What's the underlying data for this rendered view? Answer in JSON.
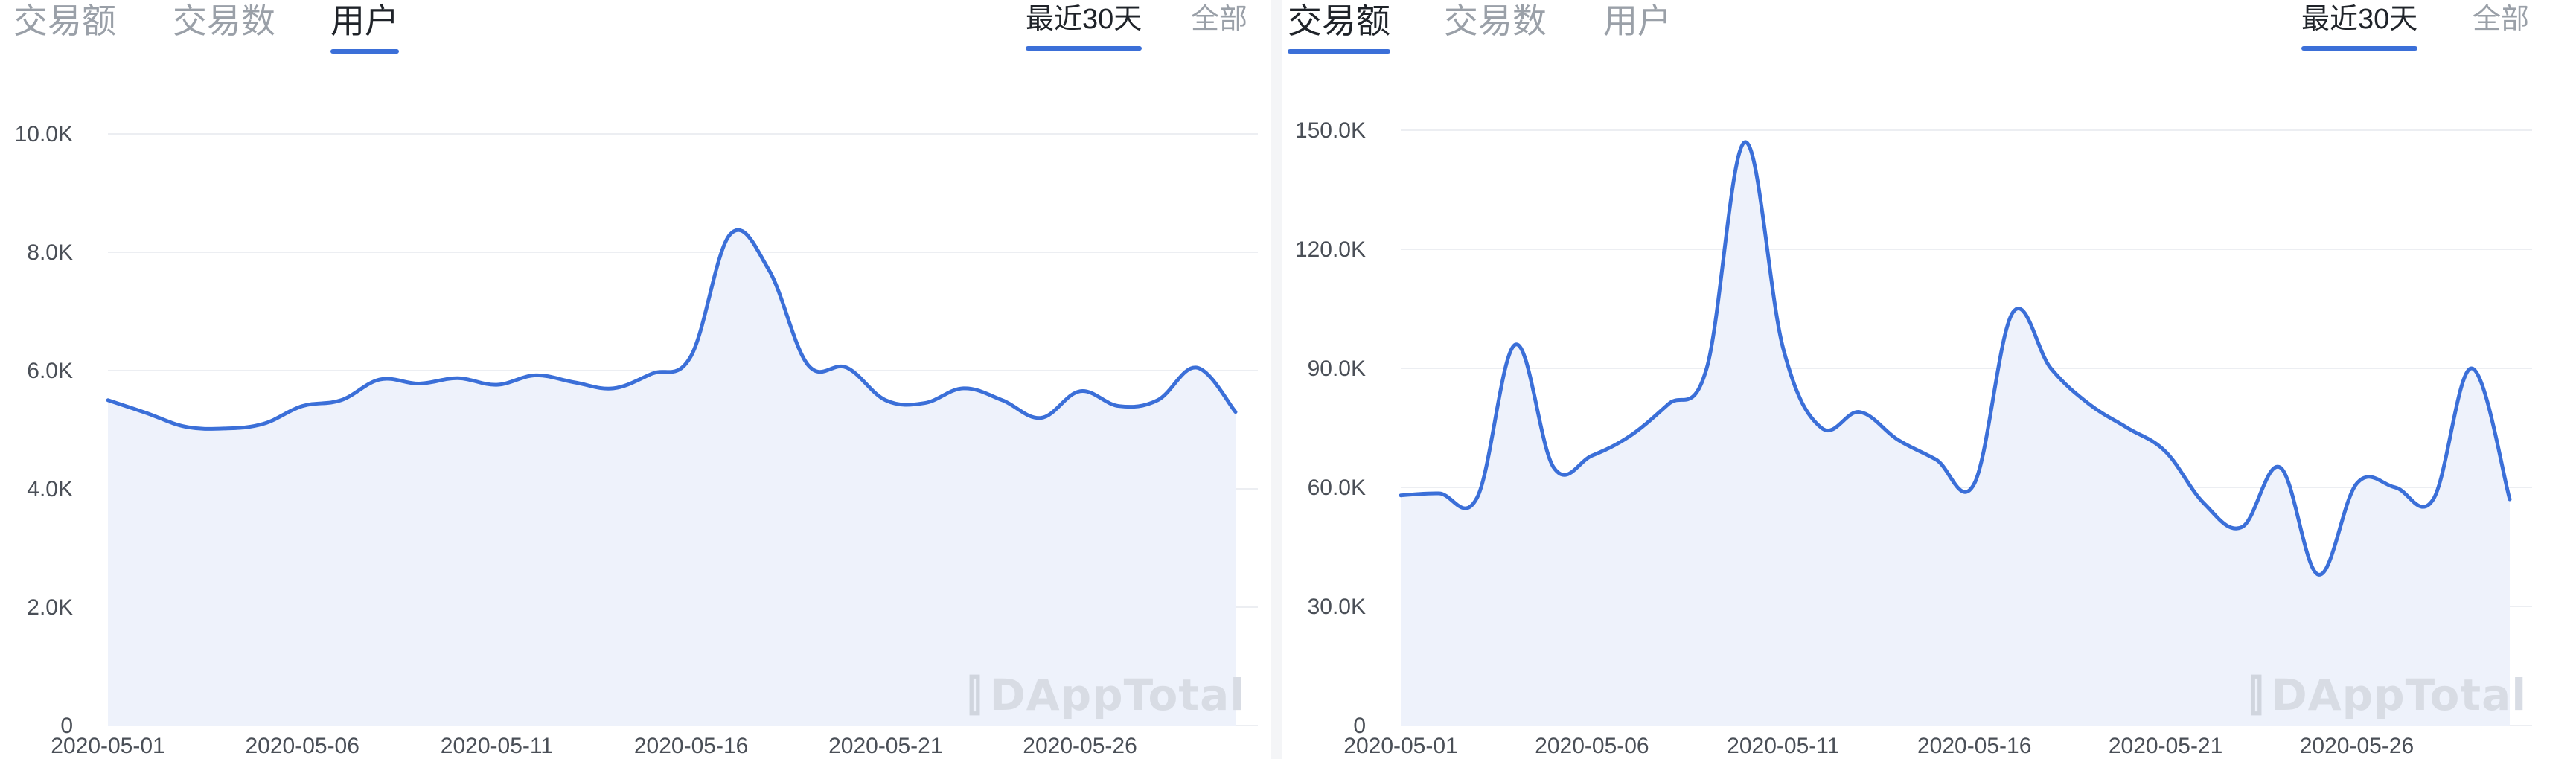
{
  "panels": [
    {
      "tabs": [
        "交易额",
        "交易数",
        "用户"
      ],
      "active_tab": 2,
      "ranges": [
        "最近30天",
        "全部"
      ],
      "active_range": 0,
      "watermark": "DAppTotal"
    },
    {
      "tabs": [
        "交易额",
        "交易数",
        "用户"
      ],
      "active_tab": 0,
      "ranges": [
        "最近30天",
        "全部"
      ],
      "active_range": 0,
      "watermark": "DAppTotal"
    }
  ],
  "colors": {
    "line": "#3b6fd8",
    "area": "#eef2fb",
    "grid": "#eceef2",
    "tab_active": "#3b6fd8"
  },
  "chart_data": [
    {
      "type": "area",
      "title": "",
      "xlabel": "",
      "ylabel": "",
      "x_labels": [
        "2020-05-01",
        "2020-05-06",
        "2020-05-11",
        "2020-05-16",
        "2020-05-21",
        "2020-05-26"
      ],
      "y_ticks": [
        "0",
        "2.0K",
        "4.0K",
        "6.0K",
        "8.0K",
        "10.0K"
      ],
      "ylim": [
        0,
        10000
      ],
      "grid": true,
      "series": [
        {
          "values": [
            5500,
            5280,
            5050,
            5020,
            5100,
            5400,
            5500,
            5850,
            5780,
            5870,
            5760,
            5920,
            5800,
            5700,
            5950,
            6250,
            8300,
            7700,
            6100,
            6050,
            5500,
            5450,
            5700,
            5500,
            5200,
            5650,
            5400,
            5500,
            6050,
            5300
          ]
        }
      ]
    },
    {
      "type": "area",
      "title": "",
      "xlabel": "",
      "ylabel": "",
      "x_labels": [
        "2020-05-01",
        "2020-05-06",
        "2020-05-11",
        "2020-05-16",
        "2020-05-21",
        "2020-05-26"
      ],
      "y_ticks": [
        "0",
        "30.0K",
        "60.0K",
        "90.0K",
        "120.0K",
        "150.0K"
      ],
      "ylim": [
        0,
        150000
      ],
      "grid": true,
      "series": [
        {
          "values": [
            58000,
            58500,
            57500,
            96000,
            65000,
            68000,
            73000,
            81000,
            90000,
            147000,
            95000,
            75000,
            79000,
            72000,
            67000,
            61000,
            104000,
            90000,
            81000,
            75000,
            69000,
            56000,
            50000,
            65000,
            38000,
            61000,
            60000,
            57000,
            90000,
            57000
          ]
        }
      ]
    }
  ]
}
